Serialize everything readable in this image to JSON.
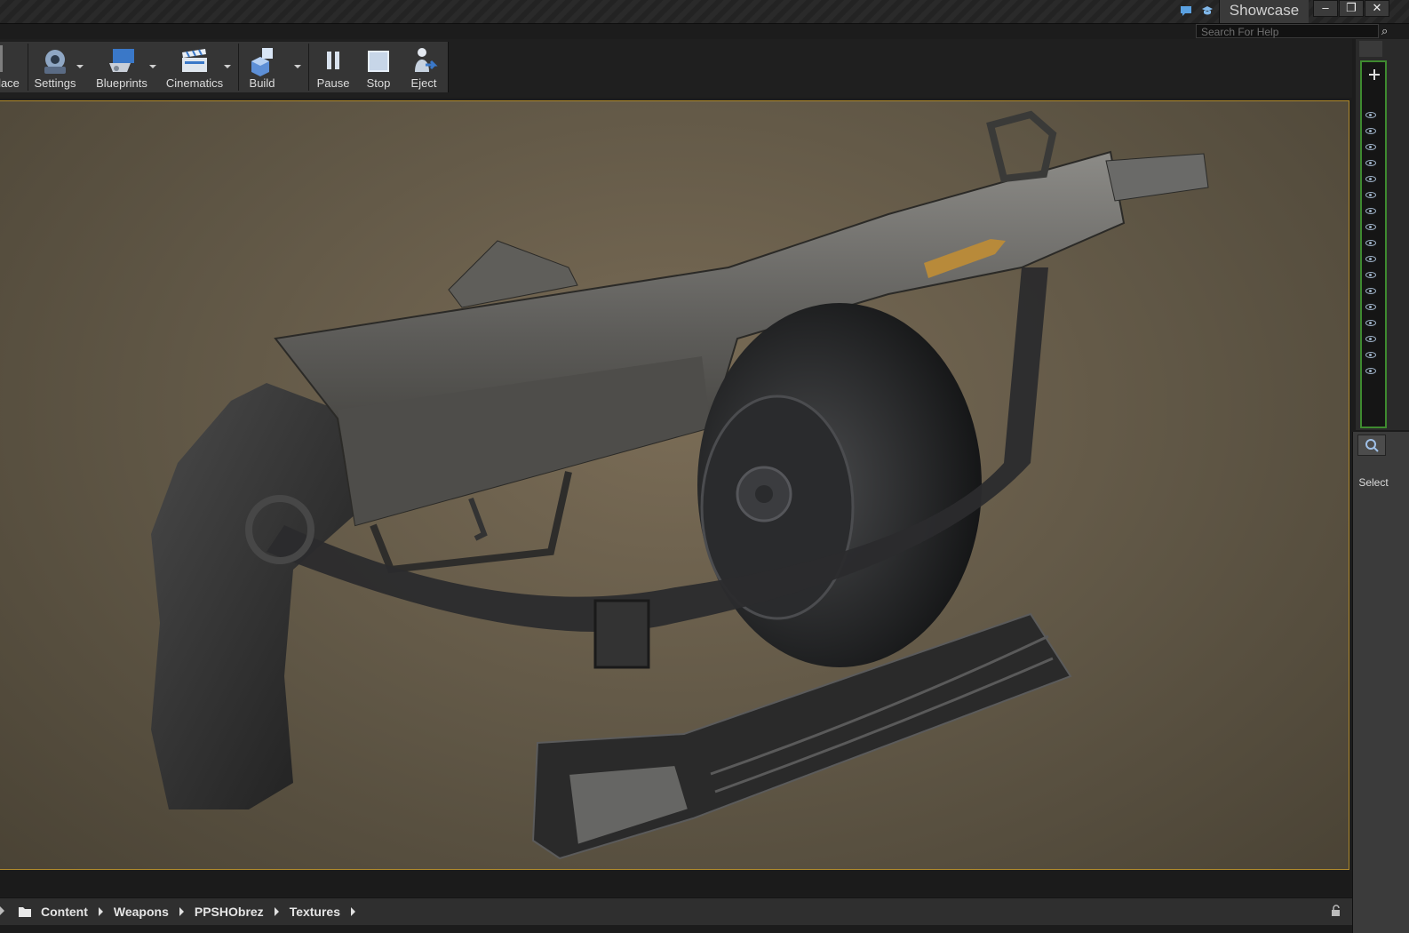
{
  "window": {
    "tab_title": "Showcase",
    "help_search_placeholder": "Search For Help",
    "buttons": {
      "minimize": "–",
      "restore": "❐",
      "close": "✕"
    }
  },
  "toolbar": {
    "items": [
      {
        "label": "lace",
        "icon": "place-icon"
      },
      {
        "label": "Settings",
        "icon": "settings-icon"
      },
      {
        "label": "Blueprints",
        "icon": "blueprints-icon"
      },
      {
        "label": "Cinematics",
        "icon": "cinematics-icon"
      },
      {
        "label": "Build",
        "icon": "build-icon"
      },
      {
        "label": "Pause",
        "icon": "pause-icon"
      },
      {
        "label": "Stop",
        "icon": "stop-icon"
      },
      {
        "label": "Eject",
        "icon": "eject-icon"
      }
    ]
  },
  "details": {
    "select_label": "Select"
  },
  "content_browser": {
    "breadcrumbs": [
      "Content",
      "Weapons",
      "PPSHObrez",
      "Textures"
    ]
  },
  "colors": {
    "viewport_border": "#b08a2c",
    "outliner_border": "#3e8a2f",
    "viewport_bg": "#6a5f4c"
  }
}
